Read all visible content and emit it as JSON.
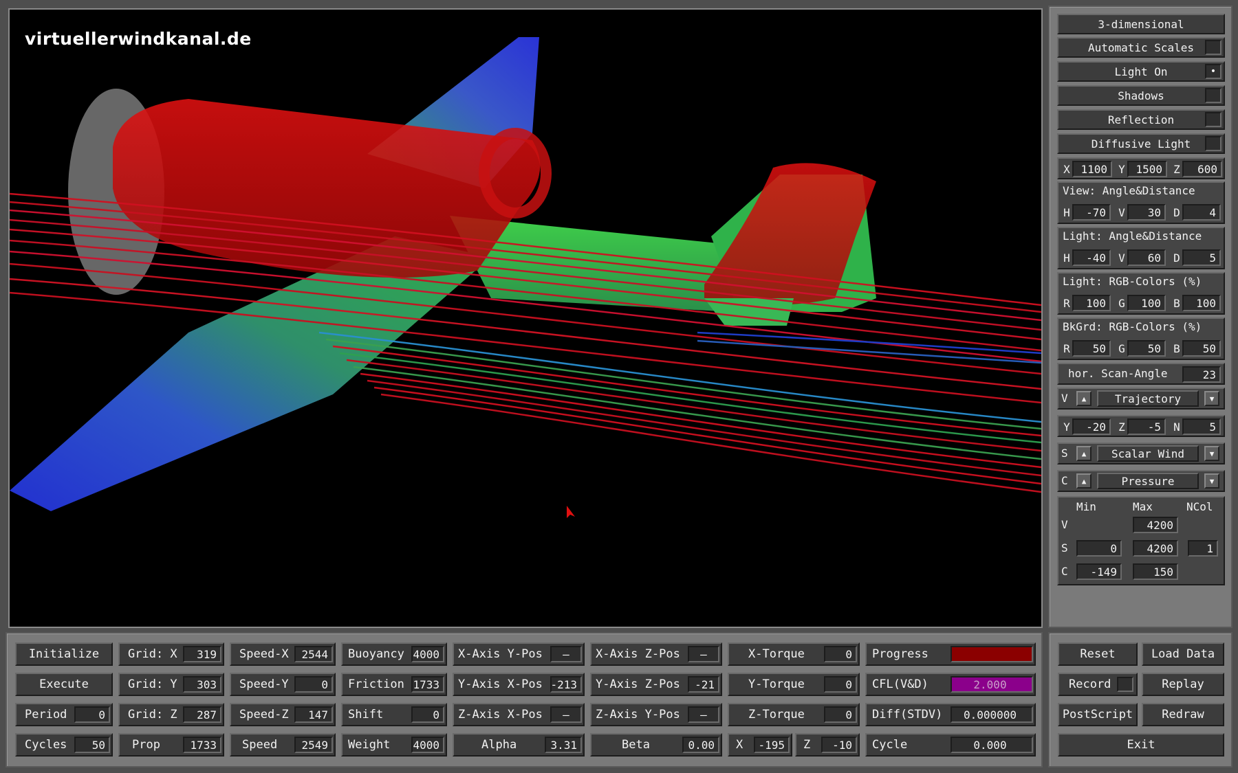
{
  "viewport": {
    "brand": "virtuellerwindkanal.de"
  },
  "side": {
    "mode_button": "3-dimensional",
    "toggles": [
      {
        "label": "Automatic Scales",
        "checked": ""
      },
      {
        "label": "Light On",
        "checked": "•"
      },
      {
        "label": "Shadows",
        "checked": ""
      },
      {
        "label": "Reflection",
        "checked": ""
      },
      {
        "label": "Diffusive Light",
        "checked": ""
      }
    ],
    "pos": [
      {
        "k": "X",
        "v": "1100"
      },
      {
        "k": "Y",
        "v": "1500"
      },
      {
        "k": "Z",
        "v": "600"
      }
    ],
    "view": {
      "title": "View:  Angle&Distance",
      "f": [
        {
          "k": "H",
          "v": "-70"
        },
        {
          "k": "V",
          "v": "30"
        },
        {
          "k": "D",
          "v": "4"
        }
      ]
    },
    "light": {
      "title": "Light: Angle&Distance",
      "f": [
        {
          "k": "H",
          "v": "-40"
        },
        {
          "k": "V",
          "v": "60"
        },
        {
          "k": "D",
          "v": "5"
        }
      ]
    },
    "light_rgb": {
      "title": "Light: RGB-Colors (%)",
      "f": [
        {
          "k": "R",
          "v": "100"
        },
        {
          "k": "G",
          "v": "100"
        },
        {
          "k": "B",
          "v": "100"
        }
      ]
    },
    "bkgrd_rgb": {
      "title": "BkGrd: RGB-Colors (%)",
      "f": [
        {
          "k": "R",
          "v": "50"
        },
        {
          "k": "G",
          "v": "50"
        },
        {
          "k": "B",
          "v": "50"
        }
      ]
    },
    "scan": {
      "label": "hor. Scan-Angle",
      "value": "23"
    },
    "v_sel": {
      "k": "V",
      "value": "Trajectory"
    },
    "yzn": [
      {
        "k": "Y",
        "v": "-20"
      },
      {
        "k": "Z",
        "v": "-5"
      },
      {
        "k": "N",
        "v": "5"
      }
    ],
    "s_sel": {
      "k": "S",
      "value": "Scalar Wind"
    },
    "c_sel": {
      "k": "C",
      "value": "Pressure"
    },
    "range": {
      "hdr_min": "Min",
      "hdr_max": "Max",
      "hdr_ncol": "NCol",
      "v": {
        "k": "V",
        "max": "4200"
      },
      "s": {
        "k": "S",
        "min": "0",
        "max": "4200",
        "ncol": "1"
      },
      "c": {
        "k": "C",
        "min": "-149",
        "max": "150"
      }
    }
  },
  "bottom": {
    "initialize": "Initialize",
    "execute": "Execute",
    "period": {
      "label": "Period",
      "value": "0"
    },
    "cycles": {
      "label": "Cycles",
      "value": "50"
    },
    "grid_x": {
      "label": "Grid: X",
      "value": "319"
    },
    "grid_y": {
      "label": "Grid: Y",
      "value": "303"
    },
    "grid_z": {
      "label": "Grid: Z",
      "value": "287"
    },
    "prop": {
      "label": "Prop",
      "value": "1733"
    },
    "speed_x": {
      "label": "Speed-X",
      "value": "2544"
    },
    "speed_y": {
      "label": "Speed-Y",
      "value": "0"
    },
    "speed_z": {
      "label": "Speed-Z",
      "value": "147"
    },
    "speed": {
      "label": "Speed",
      "value": "2549"
    },
    "buoyancy": {
      "label": "Buoyancy",
      "value": "4000"
    },
    "friction": {
      "label": "Friction",
      "value": "1733"
    },
    "shift": {
      "label": "Shift",
      "value": "0"
    },
    "weight": {
      "label": "Weight",
      "value": "4000"
    },
    "xaxis_ypos": {
      "label": "X-Axis Y-Pos",
      "value": "—"
    },
    "yaxis_xpos": {
      "label": "Y-Axis X-Pos",
      "value": "-213"
    },
    "zaxis_xpos": {
      "label": "Z-Axis X-Pos",
      "value": "—"
    },
    "alpha": {
      "label": "Alpha",
      "value": "3.31"
    },
    "xaxis_zpos": {
      "label": "X-Axis Z-Pos",
      "value": "—"
    },
    "yaxis_zpos": {
      "label": "Y-Axis Z-Pos",
      "value": "-21"
    },
    "zaxis_ypos": {
      "label": "Z-Axis Y-Pos",
      "value": "—"
    },
    "beta": {
      "label": "Beta",
      "value": "0.00"
    },
    "x_torque": {
      "label": "X-Torque",
      "value": "0"
    },
    "y_torque": {
      "label": "Y-Torque",
      "value": "0"
    },
    "z_torque": {
      "label": "Z-Torque",
      "value": "0"
    },
    "x": {
      "label": "X",
      "value": "-195"
    },
    "z": {
      "label": "Z",
      "value": "-10"
    },
    "progress": {
      "label": "Progress",
      "value": "",
      "fraction": 1.0,
      "color": "#8b0000"
    },
    "cfl": {
      "label": "CFL(V&D)",
      "value": "2.000",
      "color": "#8b008b"
    },
    "diff": {
      "label": "Diff(STDV)",
      "value": "0.000000"
    },
    "cycle": {
      "label": "Cycle",
      "value": "0.000"
    },
    "reset": "Reset",
    "load_data": "Load Data",
    "record": "Record",
    "replay": "Replay",
    "postscript": "PostScript",
    "redraw": "Redraw",
    "exit": "Exit"
  }
}
